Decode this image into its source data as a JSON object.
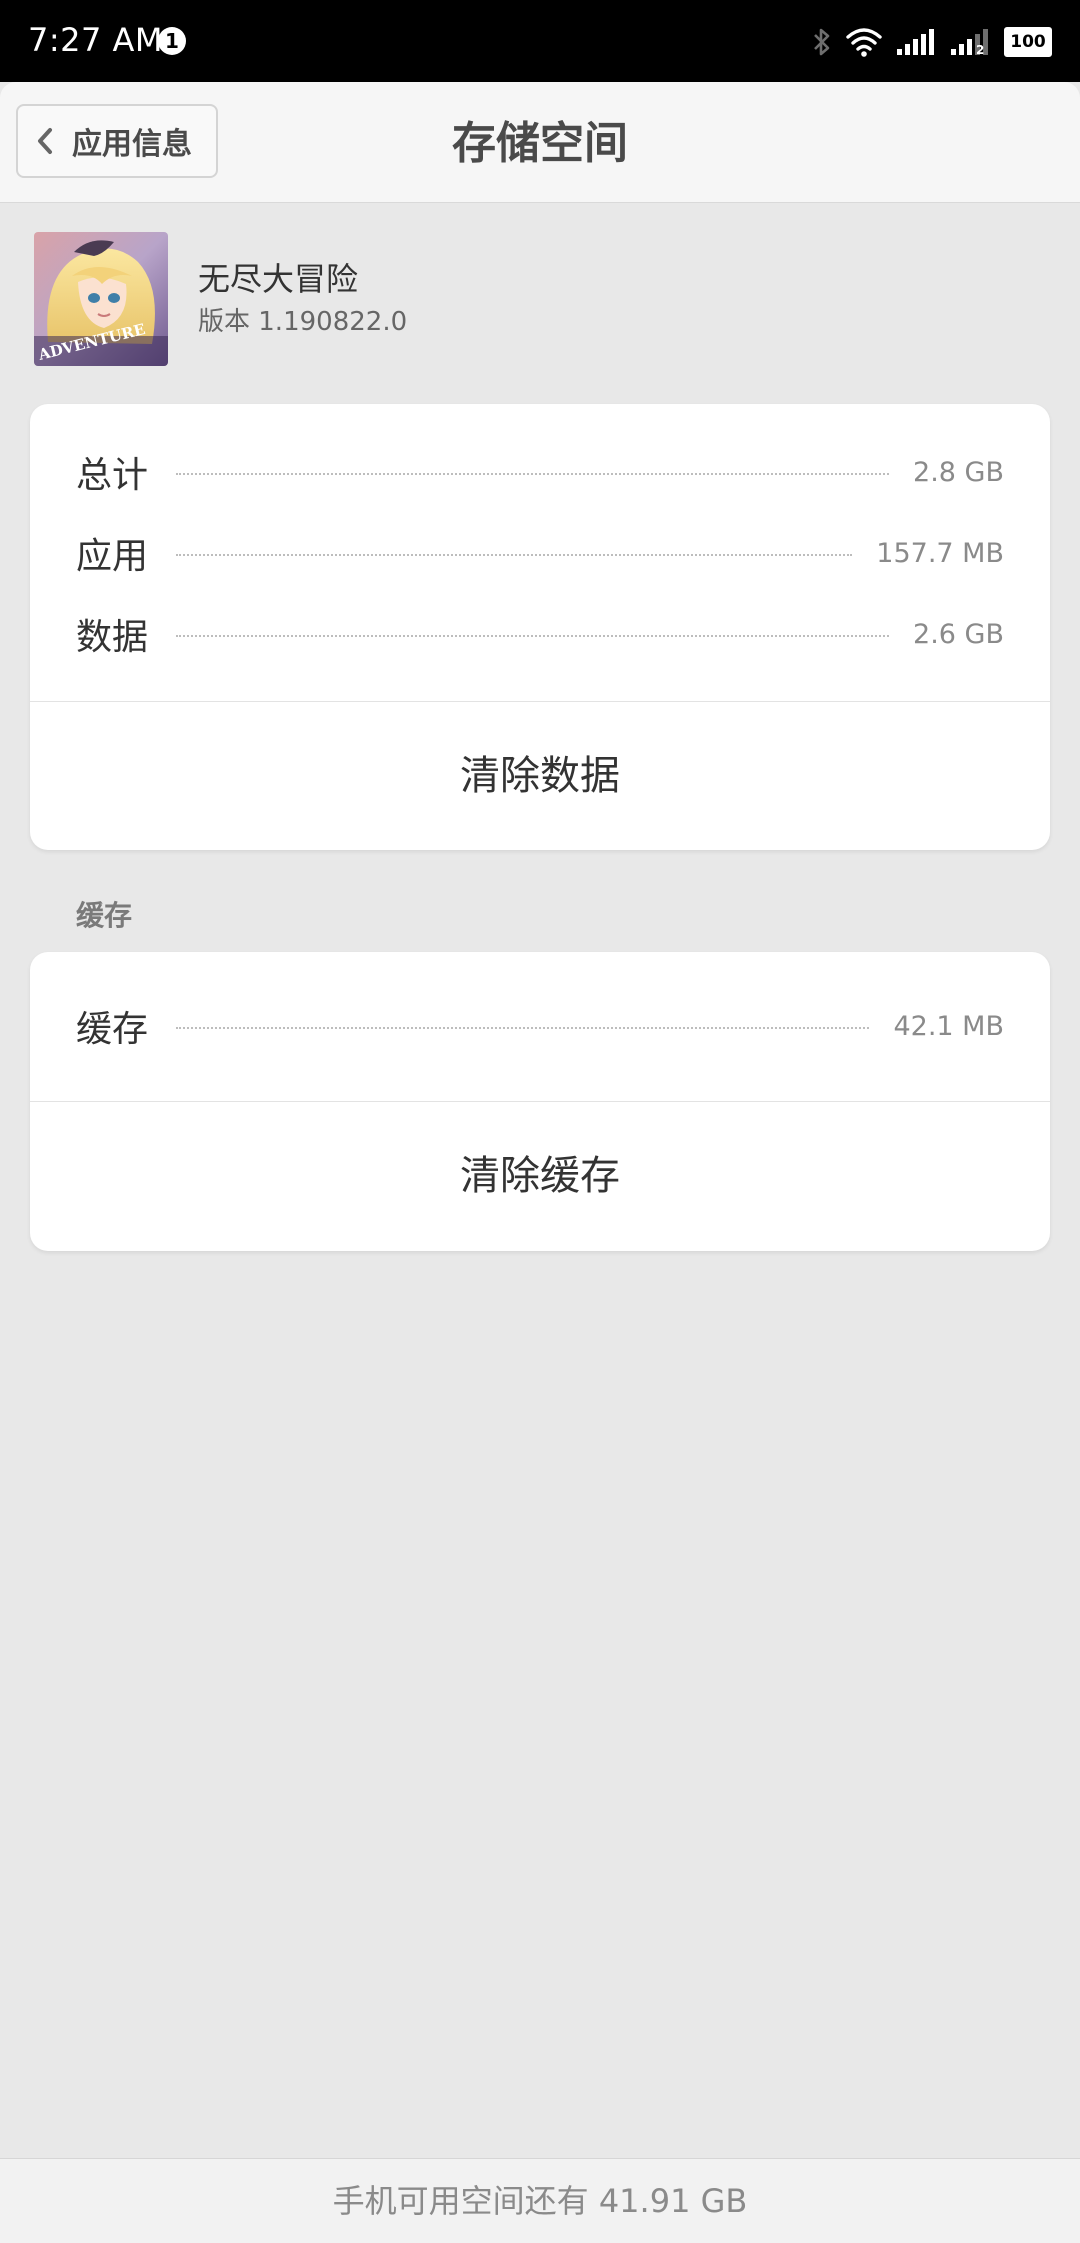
{
  "status_bar": {
    "time": "7:27 AM",
    "notification_count": "1",
    "battery_level": "100",
    "sim2_label": "2"
  },
  "header": {
    "back_label": "应用信息",
    "title": "存储空间"
  },
  "app": {
    "name": "无尽大冒险",
    "version": "版本 1.190822.0",
    "icon_text": "ADVENTURE"
  },
  "storage": {
    "rows": [
      {
        "label": "总计",
        "value": "2.8 GB"
      },
      {
        "label": "应用",
        "value": "157.7 MB"
      },
      {
        "label": "数据",
        "value": "2.6 GB"
      }
    ],
    "action_label": "清除数据"
  },
  "cache": {
    "section_title": "缓存",
    "rows": [
      {
        "label": "缓存",
        "value": "42.1 MB"
      }
    ],
    "action_label": "清除缓存"
  },
  "footer": {
    "text": "手机可用空间还有 41.91 GB"
  },
  "colors": {
    "background": "#e8e8e8",
    "card": "#ffffff",
    "header": "#f6f6f6",
    "text_primary": "#333333",
    "text_secondary": "#8a8a8a"
  }
}
